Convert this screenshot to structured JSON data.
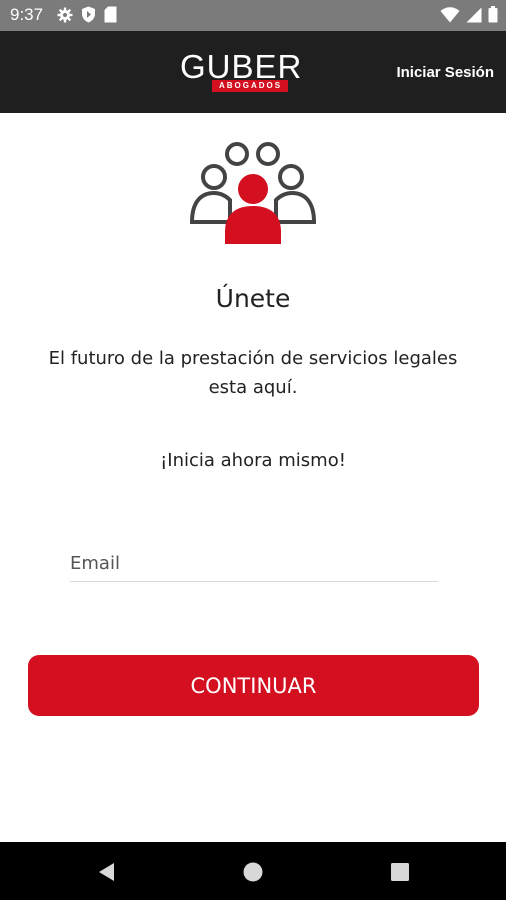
{
  "status_bar": {
    "time": "9:37",
    "left_icons": [
      "gear-icon",
      "shield-icon",
      "sd-card-icon"
    ],
    "right_icons": [
      "wifi-icon",
      "signal-icon",
      "battery-icon"
    ]
  },
  "app_bar": {
    "logo_text": "GUBER",
    "logo_subtext": "ABOGADOS",
    "login_label": "Iniciar Sesión"
  },
  "main": {
    "hero_icon": "group-people-icon",
    "title": "Únete",
    "description": "El futuro de la prestación de servicios legales esta aquí.",
    "cta_text": "¡Inicia ahora mismo!",
    "email": {
      "placeholder": "Email",
      "value": ""
    },
    "continue_label": "CONTINUAR"
  },
  "nav_bar": {
    "buttons": [
      "back-icon",
      "home-icon",
      "recents-icon"
    ]
  },
  "colors": {
    "accent": "#d40f1f",
    "app_bar": "#1f1f1f",
    "status_bar": "#7b7b7b",
    "icon_outline": "#444444"
  }
}
